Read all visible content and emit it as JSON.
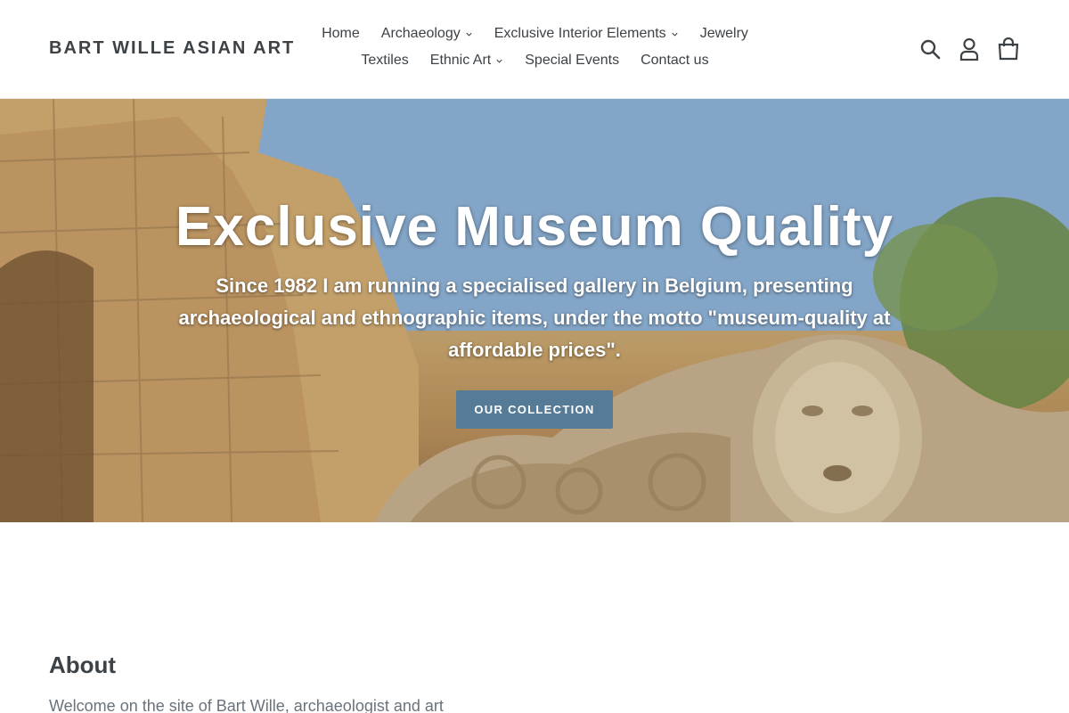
{
  "header": {
    "logo": "BART WILLE ASIAN ART",
    "nav": [
      {
        "label": "Home",
        "dropdown": false
      },
      {
        "label": "Archaeology",
        "dropdown": true
      },
      {
        "label": "Exclusive Interior Elements",
        "dropdown": true
      },
      {
        "label": "Jewelry",
        "dropdown": false
      },
      {
        "label": "Textiles",
        "dropdown": false
      },
      {
        "label": "Ethnic Art",
        "dropdown": true
      },
      {
        "label": "Special Events",
        "dropdown": false
      },
      {
        "label": "Contact us",
        "dropdown": false
      }
    ],
    "icons": [
      "search-icon",
      "account-icon",
      "cart-icon"
    ]
  },
  "hero": {
    "title": "Exclusive Museum Quality",
    "subtitle": "Since 1982 I am running a specialised gallery in Belgium, presenting archaeological and ethnographic items, under the motto \"museum-quality at affordable prices\".",
    "button": "OUR COLLECTION"
  },
  "about": {
    "heading": "About",
    "text": "Welcome on the site of Bart Wille, archaeologist and art"
  },
  "colors": {
    "text": "#3d4246",
    "button": "#557b97",
    "muted": "#69727b"
  }
}
